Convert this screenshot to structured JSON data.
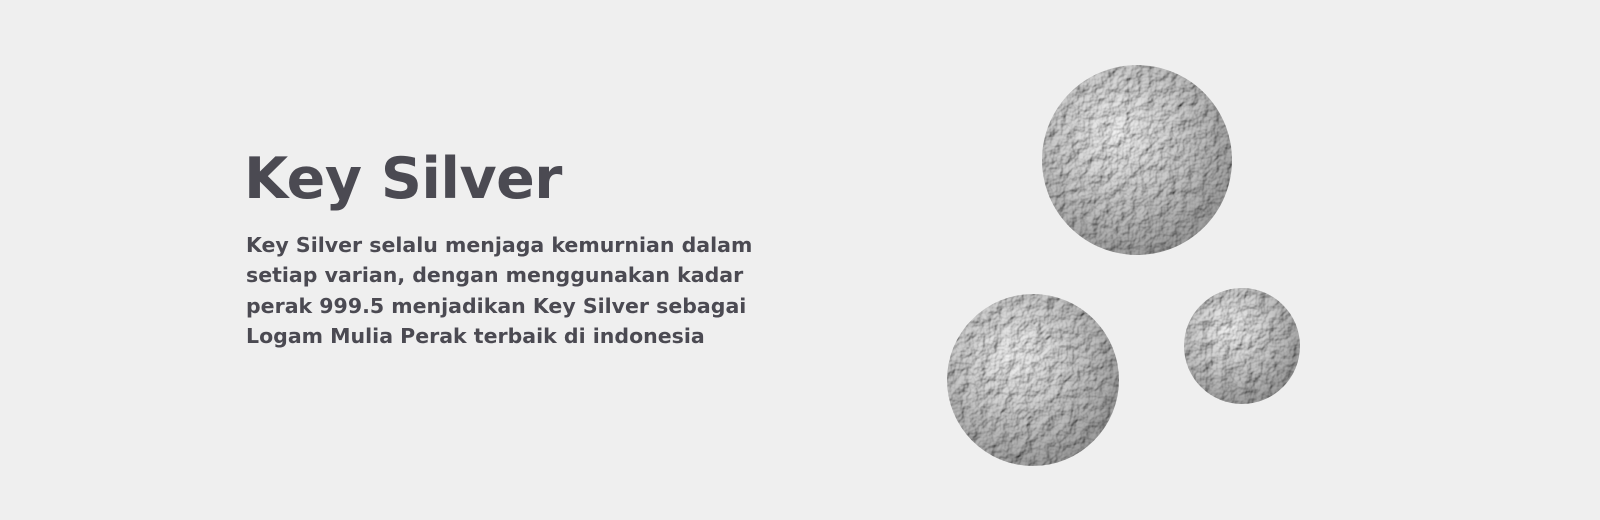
{
  "hero": {
    "title": "Key Silver",
    "description": "Key Silver selalu menjaga kemurnian dalam setiap varian, dengan menggunakan kadar perak 999.5 menjadikan Key Silver sebagai Logam Mulia Perak terbaik di indonesia"
  },
  "colors": {
    "background": "#efefef",
    "text": "#4b4a52"
  }
}
